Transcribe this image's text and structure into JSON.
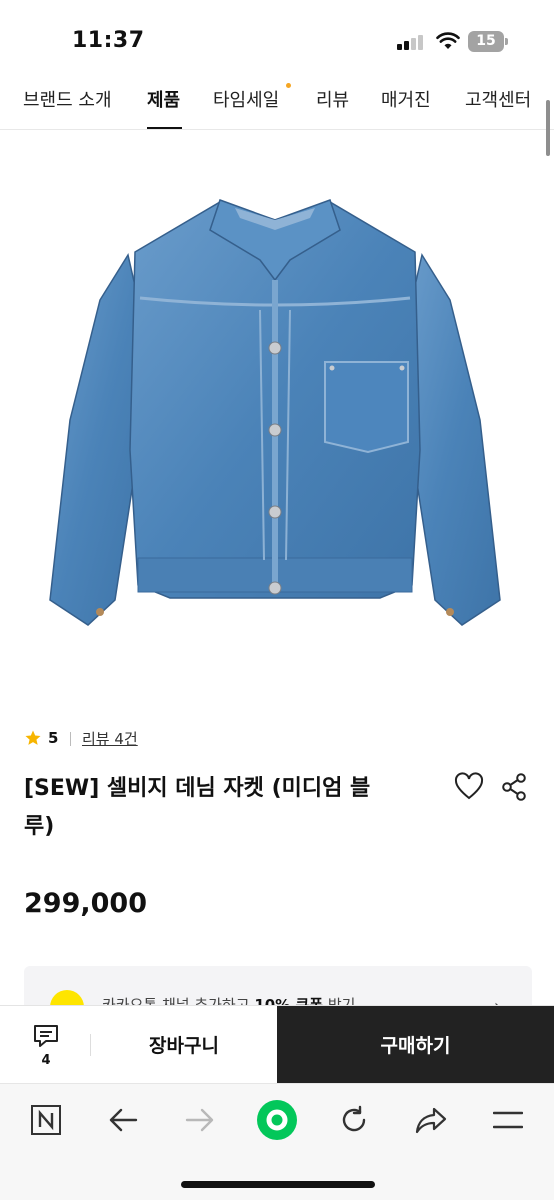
{
  "status_bar": {
    "time": "11:37",
    "battery": "15"
  },
  "nav": {
    "items": [
      {
        "label": "브랜드 소개",
        "active": false
      },
      {
        "label": "제품",
        "active": true
      },
      {
        "label": "타임세일",
        "active": false,
        "badge_dot": true
      },
      {
        "label": "리뷰",
        "active": false
      },
      {
        "label": "매거진",
        "active": false
      },
      {
        "label": "고객센터",
        "active": false
      }
    ]
  },
  "product": {
    "image_alt_icon": "denim-jacket-image",
    "rating": "5",
    "review_link": "리뷰 4건",
    "title_line1": "[SEW] 셀비지 데님 자켓 (미디엄 블",
    "title_line2": "루)",
    "price": "299,000"
  },
  "kakao_banner": {
    "text_prefix": "카카오톡 채널 추가하고 ",
    "text_bold": "10% 쿠폰",
    "text_suffix": " 받기",
    "chevron": "›"
  },
  "action_bar": {
    "comment_count": "4",
    "cart_label": "장바구니",
    "buy_label": "구매하기"
  },
  "browser_toolbar": {
    "icons": [
      "naver-n-icon",
      "back-arrow-icon",
      "forward-arrow-icon",
      "green-dot-icon",
      "reload-icon",
      "share-arrow-icon",
      "menu-icon"
    ]
  },
  "colors": {
    "accent_dot": "#f5a623",
    "star": "#f7b500",
    "kakao_yellow": "#fee500",
    "buy_button": "#222222",
    "green_button": "#03c75a",
    "denim": "#4b83b8"
  }
}
